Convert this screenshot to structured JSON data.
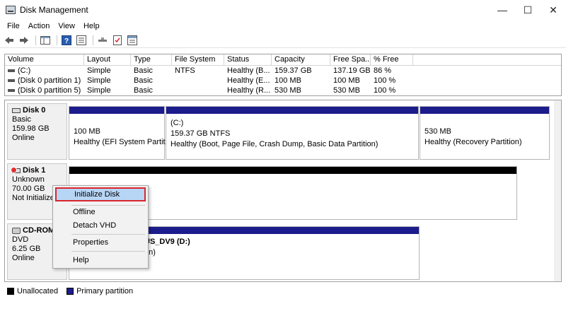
{
  "window": {
    "title": "Disk Management",
    "controls": {
      "minimize": "—",
      "maximize": "☐",
      "close": "✕"
    }
  },
  "menu": [
    "File",
    "Action",
    "View",
    "Help"
  ],
  "toolbar_icons": [
    "back-arrow-icon",
    "forward-arrow-icon",
    "console-tree-icon",
    "help-icon",
    "properties-icon",
    "connect-icon",
    "rescan-icon",
    "refresh-icon"
  ],
  "volume_table": {
    "columns": [
      "Volume",
      "Layout",
      "Type",
      "File System",
      "Status",
      "Capacity",
      "Free Spa...",
      "% Free"
    ],
    "rows": [
      [
        "(C:)",
        "Simple",
        "Basic",
        "NTFS",
        "Healthy (B...",
        "159.37 GB",
        "137.19 GB",
        "86 %"
      ],
      [
        "(Disk 0 partition 1)",
        "Simple",
        "Basic",
        "",
        "Healthy (E...",
        "100 MB",
        "100 MB",
        "100 %"
      ],
      [
        "(Disk 0 partition 5)",
        "Simple",
        "Basic",
        "",
        "Healthy (R...",
        "530 MB",
        "530 MB",
        "100 %"
      ]
    ]
  },
  "disks": [
    {
      "name": "Disk 0",
      "lines": [
        "Basic",
        "159.98 GB",
        "Online"
      ],
      "partitions": [
        {
          "line1": "100 MB",
          "line2": "Healthy (EFI System Partitic",
          "kind": "primary"
        },
        {
          "line1": "(C:)",
          "line2": "159.37 GB NTFS",
          "line3": "Healthy (Boot, Page File, Crash Dump, Basic Data Partition)",
          "kind": "primary"
        },
        {
          "line1": "530 MB",
          "line2": "Healthy (Recovery Partition)",
          "kind": "primary"
        }
      ]
    },
    {
      "name": "Disk 1",
      "lines": [
        "Unknown",
        "70.00 GB",
        "Not Initialize"
      ],
      "partitions": [
        {
          "kind": "unallocated"
        }
      ]
    },
    {
      "name": "CD-ROM",
      "lines": [
        "DVD",
        "6.25 GB",
        "Online"
      ],
      "partitions": [
        {
          "line1": "US_DV9  (D:)",
          "line2": "",
          "line3": "on)",
          "kind": "primary"
        }
      ]
    }
  ],
  "context_menu": {
    "items": [
      "Initialize Disk",
      "Offline",
      "Detach VHD",
      "Properties",
      "Help"
    ],
    "highlighted": "Initialize Disk"
  },
  "legend": [
    {
      "label": "Unallocated",
      "color": "#000000"
    },
    {
      "label": "Primary partition",
      "color": "#1c1c8c"
    }
  ]
}
